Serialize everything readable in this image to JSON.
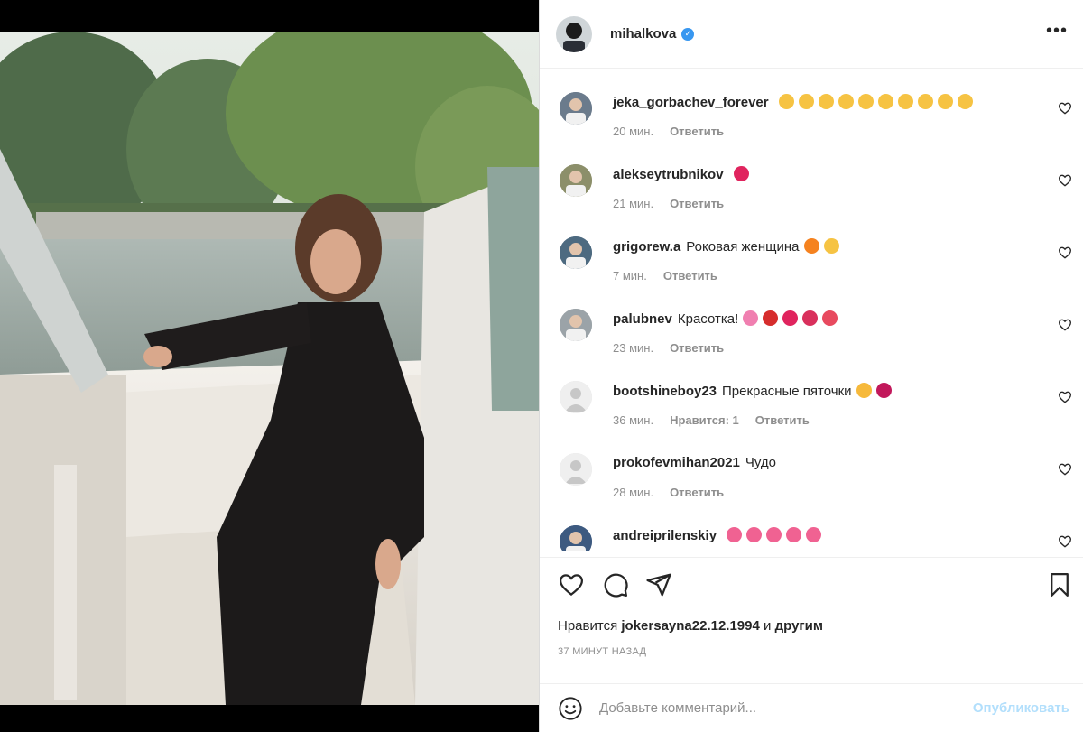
{
  "post": {
    "author": "mihalkova",
    "more_label": "•••"
  },
  "comments": [
    {
      "user": "jeka_gorbachev_forever",
      "text": "",
      "time": "20 мин.",
      "likes": "",
      "reply": "Ответить",
      "emojis": [
        "#f6c343",
        "#f6c343",
        "#f6c343",
        "#f6c343",
        "#f6c343",
        "#f6c343",
        "#f6c343",
        "#f6c343",
        "#f6c343",
        "#f6c343"
      ],
      "avatar_color": "#6b7b8c"
    },
    {
      "user": "alekseytrubnikov",
      "text": "",
      "time": "21 мин.",
      "likes": "",
      "reply": "Ответить",
      "emojis": [
        "#e0245e"
      ],
      "avatar_color": "#8c8f6a"
    },
    {
      "user": "grigorew.a",
      "text": "Роковая женщина",
      "time": "7 мин.",
      "likes": "",
      "reply": "Ответить",
      "emojis": [
        "#f5821f",
        "#f6c343"
      ],
      "avatar_color": "#4d6a80"
    },
    {
      "user": "palubnev",
      "text": "Красотка!",
      "time": "23 мин.",
      "likes": "",
      "reply": "Ответить",
      "emojis": [
        "#f07fb0",
        "#d62d2d",
        "#e0245e",
        "#d9305c",
        "#e84a5f"
      ],
      "avatar_color": "#9ba3a8"
    },
    {
      "user": "bootshineboy23",
      "text": "Прекрасные пяточки",
      "time": "36 мин.",
      "likes": "Нравится: 1",
      "reply": "Ответить",
      "emojis": [
        "#f6b93b",
        "#c2185b"
      ],
      "avatar_color": "#dbdbdb"
    },
    {
      "user": "prokofevmihan2021",
      "text": "Чудо",
      "time": "28 мин.",
      "likes": "",
      "reply": "Ответить",
      "emojis": [],
      "avatar_color": "#dbdbdb"
    },
    {
      "user": "andreiprilenskiy",
      "text": "",
      "time": "",
      "likes": "",
      "reply": "",
      "emojis": [
        "#f06292",
        "#f06292",
        "#f06292",
        "#f06292",
        "#f06292"
      ],
      "avatar_color": "#3d5a80"
    }
  ],
  "likes": {
    "prefix": "Нравится",
    "user": "jokersayna22.12.1994",
    "joiner": "и",
    "others": "другим"
  },
  "timestamp": "37 МИНУТ НАЗАД",
  "add_comment": {
    "placeholder": "Добавьте комментарий...",
    "publish_label": "Опубликовать"
  },
  "colors": {
    "text": "#262626",
    "muted": "#8e8e8e",
    "verified": "#3897f0",
    "publish_disabled": "#b2dffc"
  }
}
